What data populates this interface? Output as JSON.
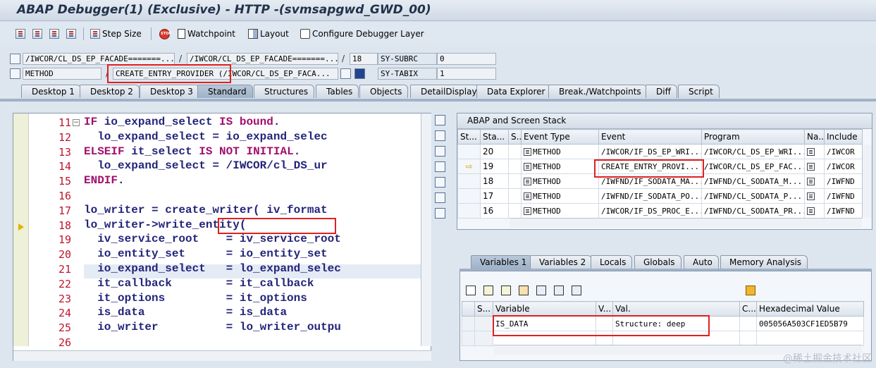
{
  "window": {
    "title": "ABAP Debugger(1)  (Exclusive) - HTTP -(svmsapgwd_GWD_00)"
  },
  "toolbar": {
    "step_size": "Step Size",
    "watchpoint": "Watchpoint",
    "layout": "Layout",
    "configure": "Configure Debugger Layer"
  },
  "info": {
    "program1": "/IWCOR/CL_DS_EP_FACADE=======...",
    "program2": "/IWCOR/CL_DS_EP_FACADE=======...",
    "line": "18",
    "subrc_label": "SY-SUBRC",
    "subrc_value": "0",
    "event_type": "METHOD",
    "event": "CREATE_ENTRY_PROVIDER (/IWCOR/CL_DS_EP_FACA...",
    "tabix_label": "SY-TABIX",
    "tabix_value": "1"
  },
  "desktop_tabs": [
    "Desktop 1",
    "Desktop 2",
    "Desktop 3",
    "Standard",
    "Structures",
    "Tables",
    "Objects",
    "DetailDisplay",
    "Data Explorer",
    "Break./Watchpoints",
    "Diff",
    "Script"
  ],
  "active_tab": "Standard",
  "code": {
    "lines": [
      {
        "n": "11",
        "text": "IF io_expand_select IS bound."
      },
      {
        "n": "12",
        "text": "  lo_expand_select = io_expand_selec"
      },
      {
        "n": "13",
        "text": "ELSEIF it_select IS NOT INITIAL."
      },
      {
        "n": "14",
        "text": "  lo_expand_select = /IWCOR/cl_DS_ur"
      },
      {
        "n": "15",
        "text": "ENDIF."
      },
      {
        "n": "16",
        "text": ""
      },
      {
        "n": "17",
        "text": "lo_writer = create_writer( iv_format"
      },
      {
        "n": "18",
        "text": "lo_writer->write_entity("
      },
      {
        "n": "19",
        "text": "  iv_service_root    = iv_service_root"
      },
      {
        "n": "20",
        "text": "  io_entity_set      = io_entity_set"
      },
      {
        "n": "21",
        "text": "  io_expand_select   = lo_expand_selec"
      },
      {
        "n": "22",
        "text": "  it_callback        = it_callback"
      },
      {
        "n": "23",
        "text": "  it_options         = it_options"
      },
      {
        "n": "24",
        "text": "  is_data            = is_data"
      },
      {
        "n": "25",
        "text": "  io_writer          = lo_writer_outpu"
      },
      {
        "n": "26",
        "text": ""
      }
    ]
  },
  "stack": {
    "title": "ABAP and Screen Stack",
    "headers": [
      "St...",
      "Sta...",
      "S...",
      "Event Type",
      "Event",
      "Program",
      "Na...",
      "Include"
    ],
    "rows": [
      {
        "sta": "20",
        "type": "METHOD",
        "event": "/IWCOR/IF_DS_EP_WRI...",
        "program": "/IWCOR/CL_DS_EP_WRI...",
        "include": "/IWCOR"
      },
      {
        "sta": "19",
        "type": "METHOD",
        "event": "CREATE_ENTRY_PROVI...",
        "program": "/IWCOR/CL_DS_EP_FAC...",
        "include": "/IWCOR"
      },
      {
        "sta": "18",
        "type": "METHOD",
        "event": "/IWFND/IF_SODATA_MA...",
        "program": "/IWFND/CL_SODATA_M...",
        "include": "/IWFND"
      },
      {
        "sta": "17",
        "type": "METHOD",
        "event": "/IWFND/IF_SODATA_PO...",
        "program": "/IWFND/CL_SODATA_P...",
        "include": "/IWFND"
      },
      {
        "sta": "16",
        "type": "METHOD",
        "event": "/IWCOR/IF_DS_PROC_E...",
        "program": "/IWFND/CL_SODATA_PR...",
        "include": "/IWFND"
      }
    ]
  },
  "var_tabs": [
    "Variables 1",
    "Variables 2",
    "Locals",
    "Globals",
    "Auto",
    "Memory Analysis"
  ],
  "variables": {
    "headers": [
      "S...",
      "Variable",
      "V...",
      "Val.",
      "C...",
      "Hexadecimal Value"
    ],
    "row": {
      "variable": "IS_DATA",
      "value": "Structure: deep",
      "hex": "005056A503CF1ED5B79"
    }
  },
  "watermark": "@稀土掘金技术社区"
}
